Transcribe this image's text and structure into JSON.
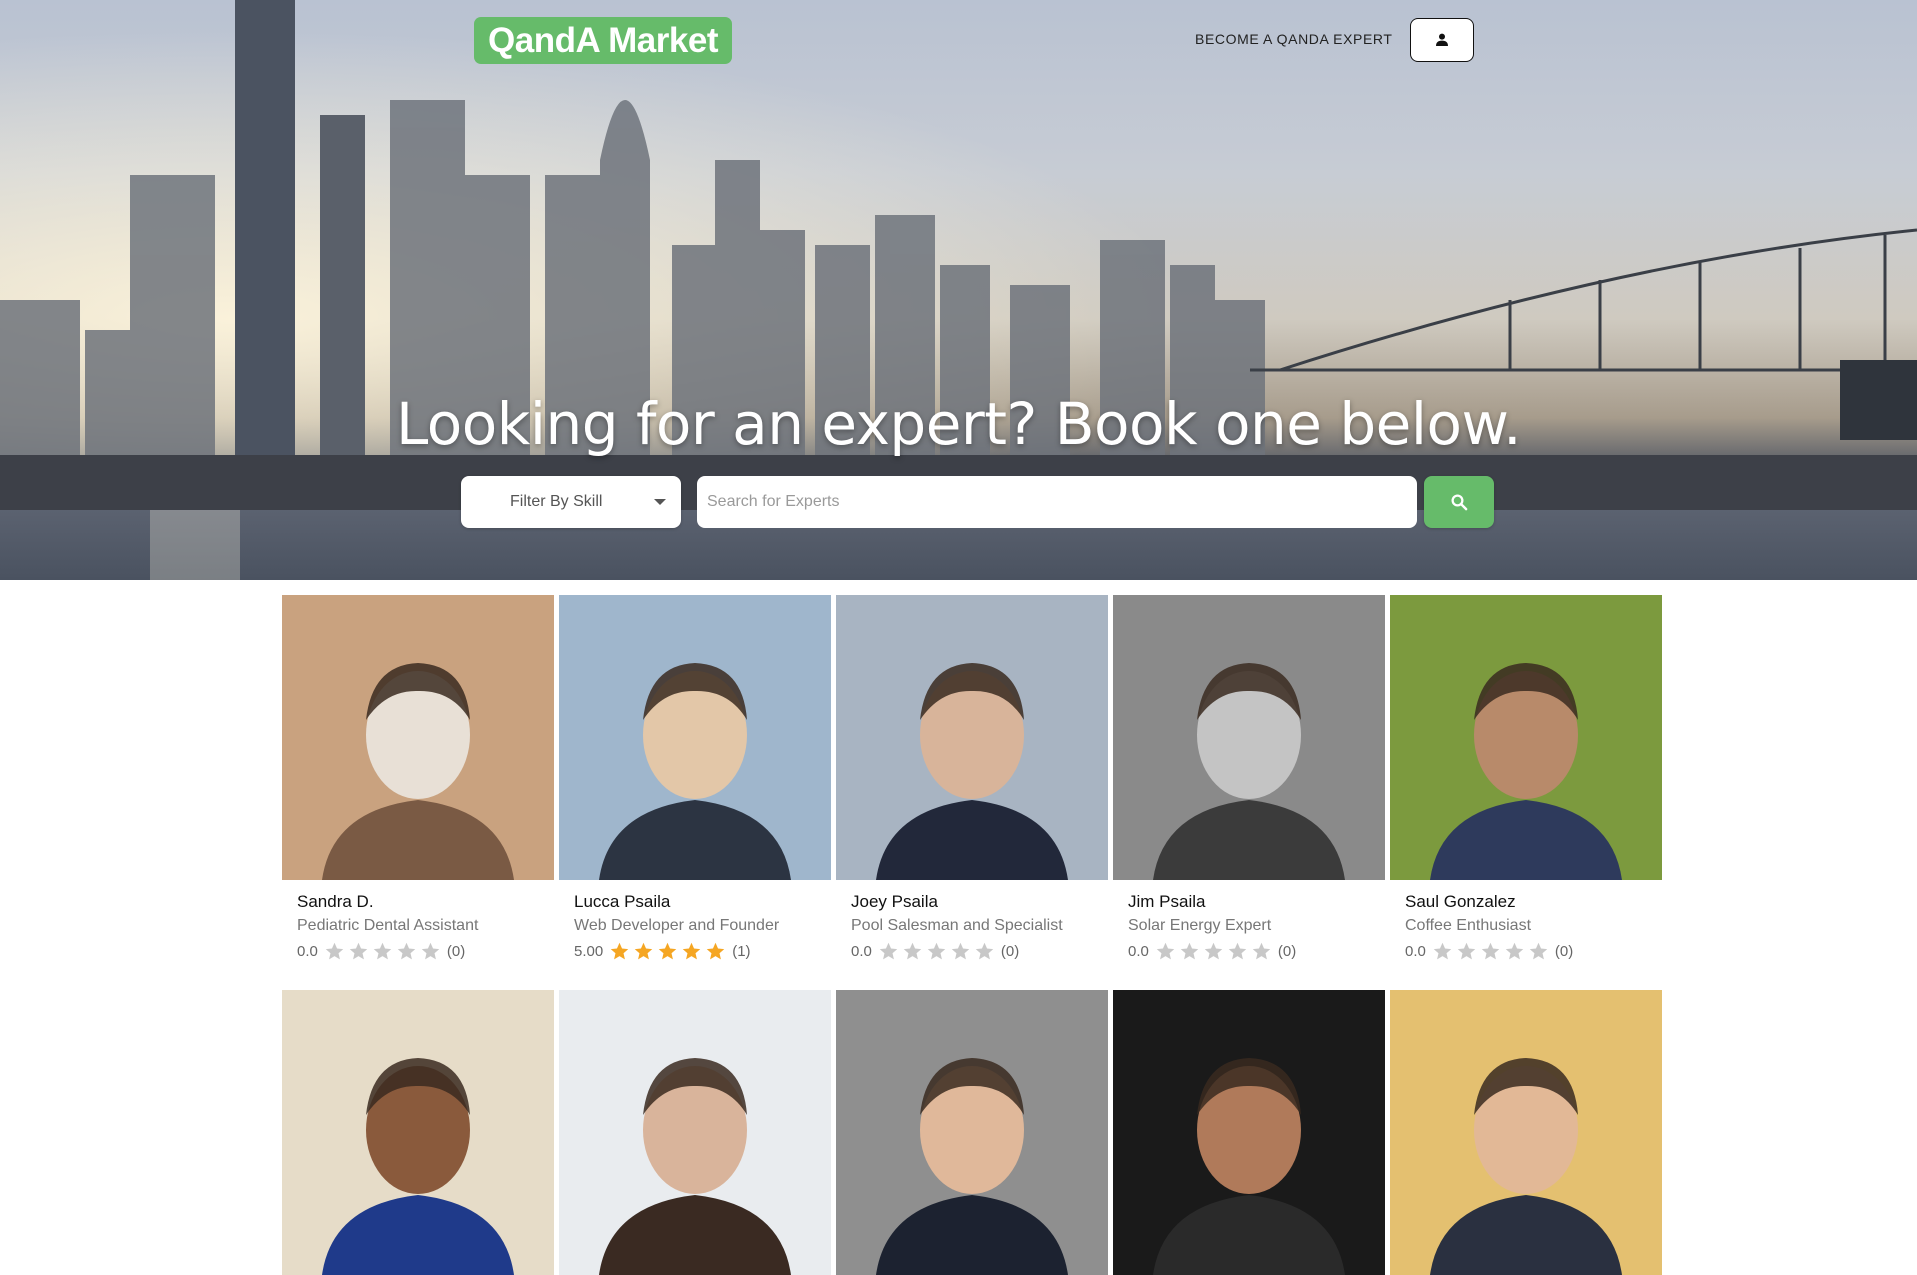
{
  "header": {
    "brand": "QandA Market",
    "become_expert": "BECOME A QANDA EXPERT",
    "account_icon": "person-icon"
  },
  "hero": {
    "headline": "Looking for an expert? Book one below.",
    "filter_label": "Filter By Skill",
    "search_placeholder": "Search for Experts",
    "search_icon": "search-icon"
  },
  "colors": {
    "accent": "#66bb6a",
    "star_filled": "#f5a623",
    "star_empty": "#c8c8c8"
  },
  "experts": [
    {
      "name": "Sandra D.",
      "title": "Pediatric Dental Assistant",
      "score": "0.0",
      "stars": 0,
      "count": "(0)"
    },
    {
      "name": "Lucca Psaila",
      "title": "Web Developer and Founder",
      "score": "5.00",
      "stars": 5,
      "count": "(1)"
    },
    {
      "name": "Joey Psaila",
      "title": "Pool Salesman and Specialist",
      "score": "0.0",
      "stars": 0,
      "count": "(0)"
    },
    {
      "name": "Jim Psaila",
      "title": "Solar Energy Expert",
      "score": "0.0",
      "stars": 0,
      "count": "(0)"
    },
    {
      "name": "Saul Gonzalez",
      "title": "Coffee Enthusiast",
      "score": "0.0",
      "stars": 0,
      "count": "(0)"
    },
    {
      "name": "",
      "title": "",
      "score": "",
      "stars": 0,
      "count": ""
    },
    {
      "name": "",
      "title": "",
      "score": "",
      "stars": 0,
      "count": ""
    },
    {
      "name": "",
      "title": "",
      "score": "",
      "stars": 0,
      "count": ""
    },
    {
      "name": "",
      "title": "",
      "score": "",
      "stars": 0,
      "count": ""
    },
    {
      "name": "",
      "title": "",
      "score": "",
      "stars": 0,
      "count": ""
    }
  ]
}
